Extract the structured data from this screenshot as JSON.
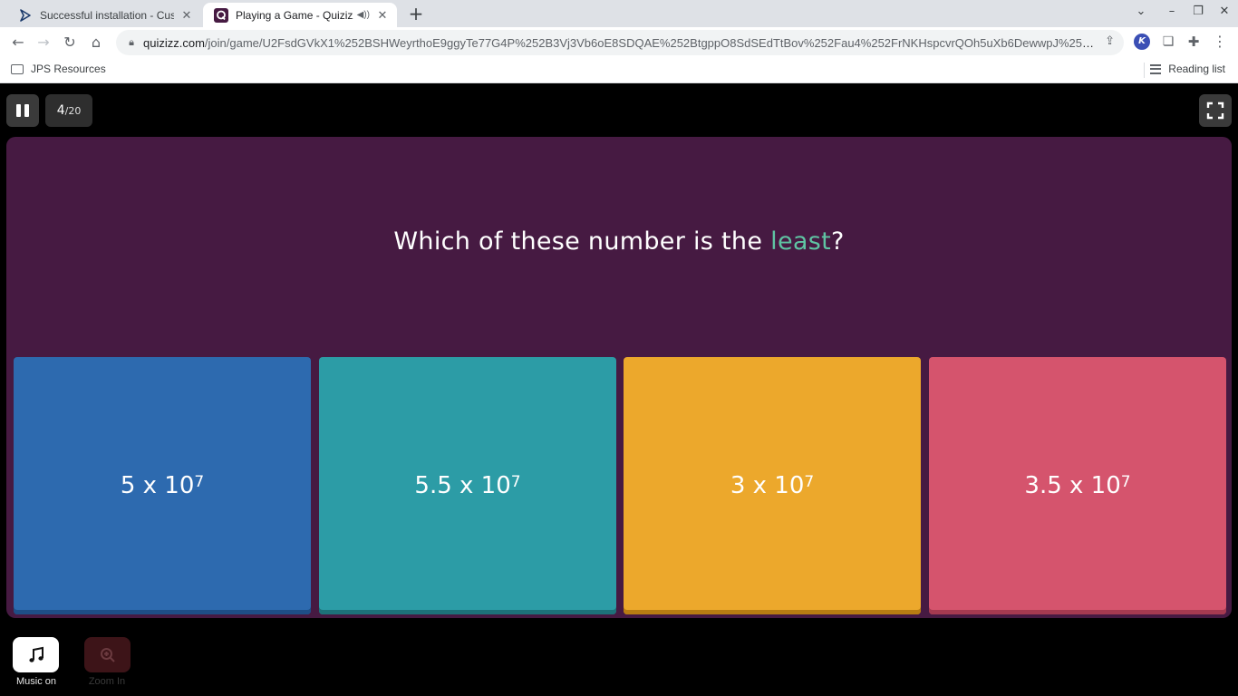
{
  "browser": {
    "tabs": [
      {
        "title": "Successful installation - Custom",
        "active": false
      },
      {
        "title": "Playing a Game - Quizizz",
        "active": true
      }
    ],
    "url_host": "quizizz.com",
    "url_path": "/join/game/U2FsdGVkX1%252BSHWeyrthoE9ggyTe77G4P%252B3Vj3Vb6oE8SDQAE%252BtgppO8SdSEdTtBov%252Fau4%252FrNKHspcvrQOh5uXb6DewwpJ%252BOi5qJ...",
    "bookmarks": {
      "folder": "JPS Resources",
      "reading_list": "Reading list"
    }
  },
  "game": {
    "counter_current": "4",
    "counter_total": "/20",
    "question": {
      "prefix": "Which of these number is the ",
      "highlight": "least",
      "suffix": "?",
      "highlight_color": "#5fc4a3"
    },
    "options": [
      {
        "base": "5 x 10",
        "exponent": "7",
        "color": "#2d6aaf"
      },
      {
        "base": "5.5 x 10",
        "exponent": "7",
        "color": "#2c9ca6"
      },
      {
        "base": "3 x 10",
        "exponent": "7",
        "color": "#eca82c"
      },
      {
        "base": "3.5 x 10",
        "exponent": "7",
        "color": "#d5546d"
      }
    ],
    "music_label": "Music on",
    "zoom_label": "Zoom In"
  },
  "icons": {
    "pause": "pause-icon",
    "fullscreen": "fullscreen-icon",
    "music": "music-note-icon",
    "zoom": "zoom-in-icon"
  }
}
